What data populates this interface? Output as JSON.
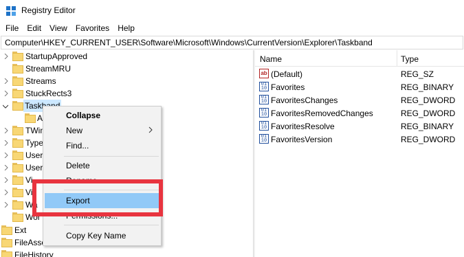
{
  "window": {
    "title": "Registry Editor"
  },
  "menubar": {
    "items": [
      "File",
      "Edit",
      "View",
      "Favorites",
      "Help"
    ]
  },
  "address": {
    "path": "Computer\\HKEY_CURRENT_USER\\Software\\Microsoft\\Windows\\CurrentVersion\\Explorer\\Taskband"
  },
  "tree": {
    "items": [
      {
        "label": "StartupApproved",
        "expander": "right"
      },
      {
        "label": "StreamMRU",
        "expander": "none"
      },
      {
        "label": "Streams",
        "expander": "right"
      },
      {
        "label": "StuckRects3",
        "expander": "right"
      },
      {
        "label": "Taskband",
        "expander": "down",
        "selected": true
      },
      {
        "label": "A",
        "expander": "none",
        "child": true
      },
      {
        "label": "TWin",
        "expander": "right"
      },
      {
        "label": "Type",
        "expander": "right"
      },
      {
        "label": "User",
        "expander": "right"
      },
      {
        "label": "User",
        "expander": "right"
      },
      {
        "label": "Vi",
        "expander": "right"
      },
      {
        "label": "Vi",
        "expander": "right"
      },
      {
        "label": "Wa",
        "expander": "right"
      },
      {
        "label": "Wor",
        "expander": "right"
      },
      {
        "label": "Ext",
        "expander": "none",
        "outer": true
      },
      {
        "label": "FileAsso",
        "expander": "none",
        "outer": true
      },
      {
        "label": "FileHistory",
        "expander": "none",
        "outer": true
      }
    ]
  },
  "values_pane": {
    "headers": {
      "name": "Name",
      "type": "Type"
    },
    "rows": [
      {
        "name": "(Default)",
        "type": "REG_SZ",
        "icon": "string-value-icon"
      },
      {
        "name": "Favorites",
        "type": "REG_BINARY",
        "icon": "binary-value-icon"
      },
      {
        "name": "FavoritesChanges",
        "type": "REG_DWORD",
        "icon": "binary-value-icon"
      },
      {
        "name": "FavoritesRemovedChanges",
        "type": "REG_DWORD",
        "icon": "binary-value-icon"
      },
      {
        "name": "FavoritesResolve",
        "type": "REG_BINARY",
        "icon": "binary-value-icon"
      },
      {
        "name": "FavoritesVersion",
        "type": "REG_DWORD",
        "icon": "binary-value-icon"
      }
    ]
  },
  "context_menu": {
    "collapse": "Collapse",
    "new": "New",
    "find": "Find...",
    "delete": "Delete",
    "rename": "Rename",
    "export": "Export",
    "permissions": "Permissions...",
    "copy_key_name": "Copy Key Name",
    "highlighted": "Export"
  },
  "colors": {
    "selection": "#cce8ff",
    "menu_highlight": "#91c9f7",
    "annotation_red": "#e8343f",
    "folder_yellow": "#f8d775"
  }
}
